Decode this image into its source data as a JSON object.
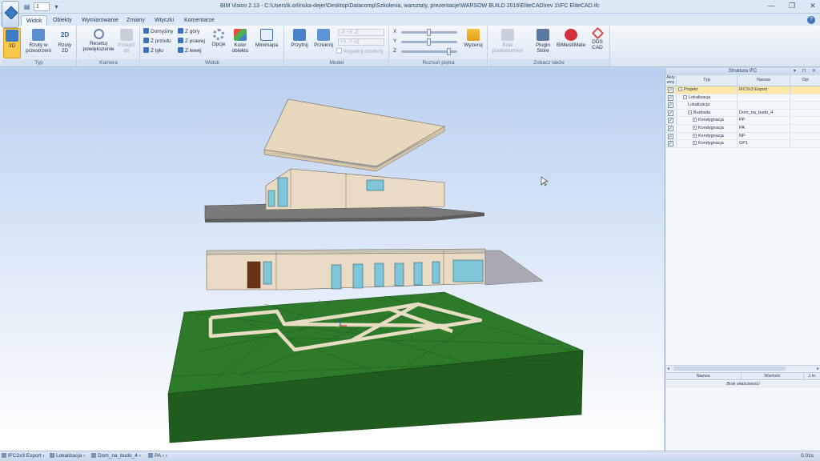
{
  "window": {
    "title": "BIM Vision 2.13 - C:\\Users\\k.orlinska-dejer\\Desktop\\Datacomp\\Szkolenia, warsztaty, prezentacje\\WARSOW BUILD 2016\\EliteCAD\\rev 1\\IFC EliteCAD.ifc",
    "qat_field": "1",
    "controls": {
      "minimize": "—",
      "maximize": "❐",
      "close": "✕"
    }
  },
  "tabs": [
    "Widok",
    "Obiekty",
    "Wymiarowanie",
    "Zmiany",
    "Wtyczki",
    "Komentarze"
  ],
  "ribbon": {
    "typ": {
      "label": "Typ",
      "btn_3d": "3D",
      "btn_rzuty_przestrzeni": "Rzuty w przestrzeni",
      "btn_rzuty_2d": "Rzuty 2D"
    },
    "kamera": {
      "label": "Kamera",
      "btn_resetuj": "Resetuj powiększenie",
      "btn_przejdz": "Przejdź do"
    },
    "widok": {
      "label": "Widok",
      "domyslny": "Domyślny",
      "z_gory": "Z góry",
      "z_przodu": "Z przodu",
      "z_prawej": "Z prawej",
      "z_tylu": "Z tyłu",
      "z_lewej": "Z lewej",
      "opcje": "Opcje",
      "kolor_obiektu": "Kolor obiektu",
      "minimapa": "Minimapa"
    },
    "model": {
      "label": "Model",
      "przytnij": "Przytnij",
      "przekroj": "Przekrój",
      "wypelnij": "Wypełnij przekrój",
      "axis_fields": [
        "-X +X -Z",
        "+Y -Y +Z"
      ]
    },
    "rozsun": {
      "label": "Rozsuń piętra",
      "x": "X",
      "y": "Y",
      "z": "Z",
      "wyzeruj": "Wyzeruj",
      "slider_x": 0.5,
      "slider_y": 0.5,
      "slider_z": 0.85
    },
    "zobacz": {
      "label": "Zobacz także",
      "brak": "Brak powiadomień",
      "plugin_store": "Plugin Store",
      "bimestimate": "BIMestiMate",
      "dds_cad": "DDS CAD"
    }
  },
  "panel": {
    "title": "Struktura IFC",
    "controls": "▾ ⊓ ✕",
    "columns": {
      "aktywny": "Akty wny",
      "typ": "Typ",
      "nazwa": "Nazwa",
      "opis": "Opi"
    },
    "rows": [
      {
        "indent": 0,
        "toggle": "−",
        "typ": "Projekt",
        "nazwa": "IFC2x3 Export",
        "selected": true
      },
      {
        "indent": 1,
        "toggle": "−",
        "typ": "Lokalizacja",
        "nazwa": ""
      },
      {
        "indent": 2,
        "toggle": "",
        "typ": "Lokalizacja",
        "nazwa": ""
      },
      {
        "indent": 2,
        "toggle": "−",
        "typ": "Budowla",
        "nazwa": "Dom_na_budo_4"
      },
      {
        "indent": 3,
        "toggle": "+",
        "typ": "Kondygnacja",
        "nazwa": "PP"
      },
      {
        "indent": 3,
        "toggle": "+",
        "typ": "Kondygnacja",
        "nazwa": "PA"
      },
      {
        "indent": 3,
        "toggle": "+",
        "typ": "Kondygnacja",
        "nazwa": "NP"
      },
      {
        "indent": 3,
        "toggle": "+",
        "typ": "Kondygnacja",
        "nazwa": "GP1"
      }
    ],
    "props": {
      "nazwa": "Nazwa",
      "wartosc": "Wartość",
      "jm": "J.m.",
      "empty": "Brak właściwości"
    }
  },
  "statusbar": {
    "crumbs": [
      "IFC2x3 Export",
      "Lokalizacja",
      "Dom_na_budo_4",
      "PA"
    ],
    "time": "0.01s"
  },
  "colors": {
    "ground": "#2a6e27",
    "wall": "#eadbc5",
    "slab": "#8c8c8c",
    "accent": "#f7c84a"
  }
}
